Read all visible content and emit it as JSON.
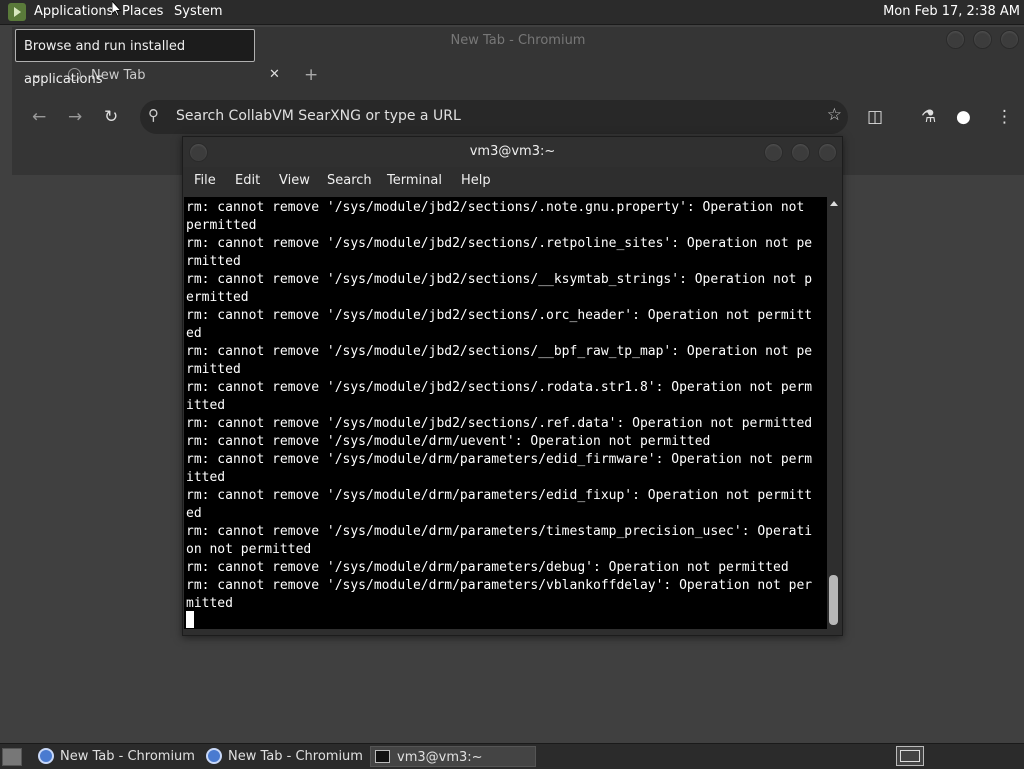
{
  "top_panel": {
    "menus": [
      "Applications",
      "Places",
      "System"
    ],
    "clock": "Mon Feb 17,  2:38 AM"
  },
  "tooltip": "Browse and run installed applications",
  "chromium": {
    "title": "New Tab - Chromium",
    "tab_label": "New Tab",
    "omnibox_placeholder": "Search CollabVM SearXNG or type a URL"
  },
  "terminal": {
    "title": "vm3@vm3:~",
    "menus": [
      "File",
      "Edit",
      "View",
      "Search",
      "Terminal",
      "Help"
    ],
    "lines": [
      "rm: cannot remove '/sys/module/jbd2/sections/.note.gnu.property': Operation not ",
      "permitted",
      "rm: cannot remove '/sys/module/jbd2/sections/.retpoline_sites': Operation not pe",
      "rmitted",
      "rm: cannot remove '/sys/module/jbd2/sections/__ksymtab_strings': Operation not p",
      "ermitted",
      "rm: cannot remove '/sys/module/jbd2/sections/.orc_header': Operation not permitt",
      "ed",
      "rm: cannot remove '/sys/module/jbd2/sections/__bpf_raw_tp_map': Operation not pe",
      "rmitted",
      "rm: cannot remove '/sys/module/jbd2/sections/.rodata.str1.8': Operation not perm",
      "itted",
      "rm: cannot remove '/sys/module/jbd2/sections/.ref.data': Operation not permitted",
      "rm: cannot remove '/sys/module/drm/uevent': Operation not permitted",
      "rm: cannot remove '/sys/module/drm/parameters/edid_firmware': Operation not perm",
      "itted",
      "rm: cannot remove '/sys/module/drm/parameters/edid_fixup': Operation not permitt",
      "ed",
      "rm: cannot remove '/sys/module/drm/parameters/timestamp_precision_usec': Operati",
      "on not permitted",
      "rm: cannot remove '/sys/module/drm/parameters/debug': Operation not permitted",
      "rm: cannot remove '/sys/module/drm/parameters/vblankoffdelay': Operation not per",
      "mitted"
    ]
  },
  "taskbar": {
    "tasks": [
      "New Tab - Chromium",
      "New Tab - Chromium",
      "vm3@vm3:~"
    ]
  },
  "colors": {
    "panel": "#2b2b2b",
    "terminal_bg": "#000000",
    "terminal_fg": "#ffffff",
    "desktop": "#404040"
  }
}
